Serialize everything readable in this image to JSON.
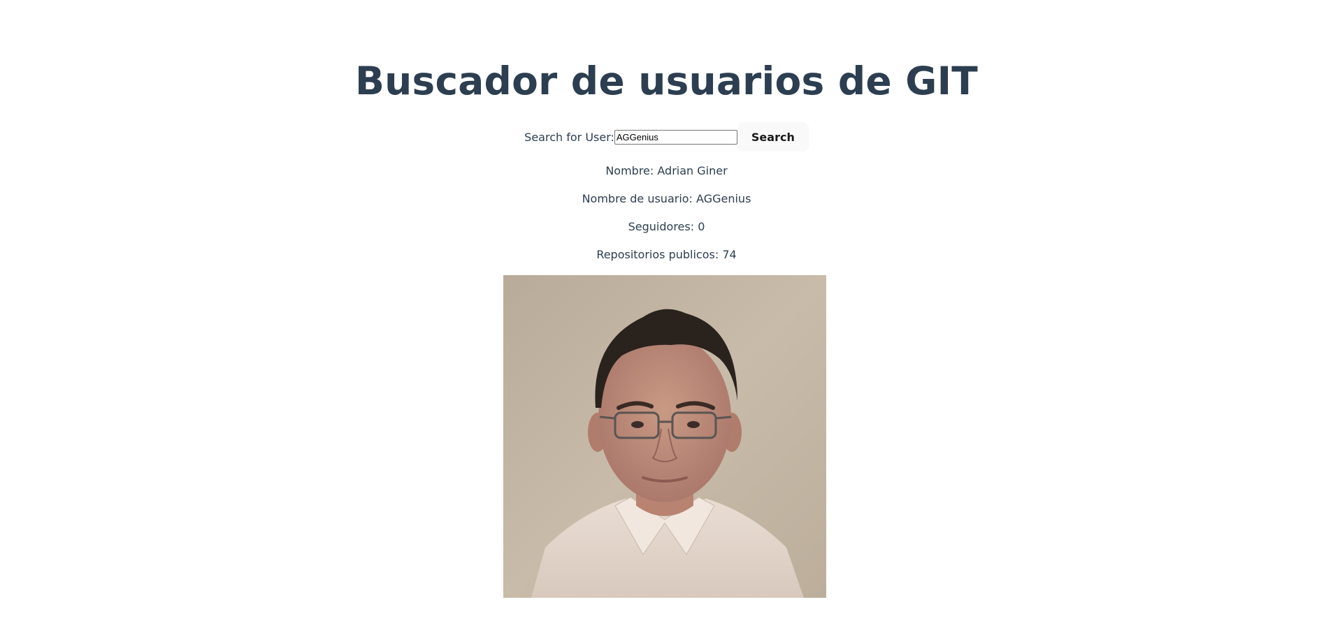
{
  "title": "Buscador de usuarios de GIT",
  "search": {
    "label": "Search for User:",
    "value": "AGGenius",
    "button_label": "Search"
  },
  "user": {
    "name_line": "Nombre: Adrian Giner",
    "username_line": "Nombre de usuario: AGGenius",
    "followers_line": "Seguidores: 0",
    "repos_line": "Repositorios publicos: 74"
  },
  "colors": {
    "text": "#2c3e50",
    "button_bg": "#f9f9f9",
    "avatar_bg": "#c2b4a2"
  }
}
